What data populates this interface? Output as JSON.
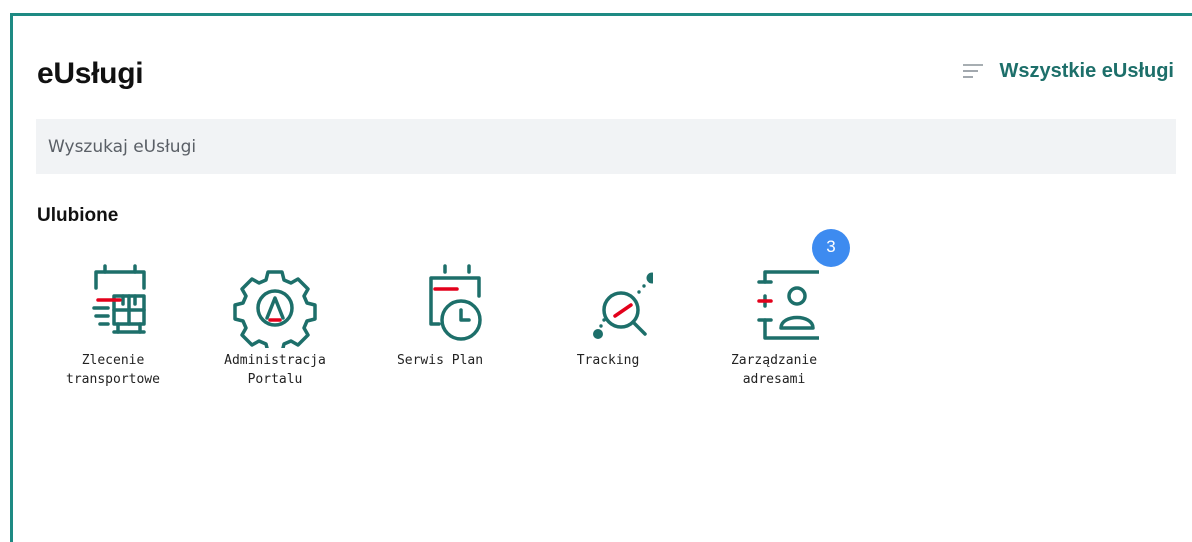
{
  "header": {
    "title": "eUsługi",
    "all_services_label": "Wszystkie eUsługi",
    "menu_icon": "menu-lines-icon"
  },
  "search": {
    "placeholder": "Wyszukaj eUsługi",
    "value": ""
  },
  "favorites": {
    "title": "Ulubione",
    "items": [
      {
        "label": "Zlecenie\ntransportowe",
        "icon": "transport-order-icon"
      },
      {
        "label": "Administracja\nPortalu",
        "icon": "portal-admin-gear-icon"
      },
      {
        "label": "Serwis Plan",
        "icon": "calendar-clock-icon"
      },
      {
        "label": "Tracking",
        "icon": "tracking-magnifier-icon"
      },
      {
        "label": "Zarządzanie\nadresami",
        "icon": "address-book-icon"
      }
    ],
    "badge_count": "3"
  },
  "colors": {
    "accent": "#1e8a83",
    "icon_teal": "#1d6f6a",
    "icon_red": "#e3001b",
    "badge": "#3d8bf0",
    "search_bg": "#f1f3f5"
  }
}
